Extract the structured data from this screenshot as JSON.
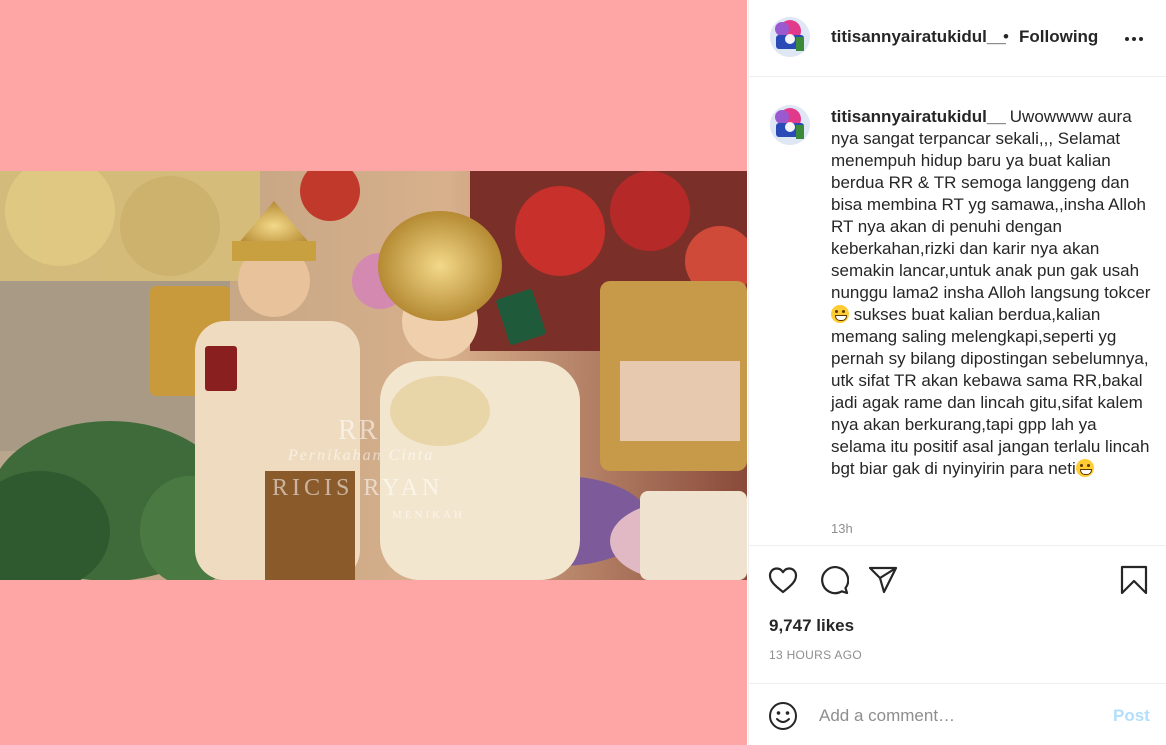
{
  "colors": {
    "media_background": "#fea6a6",
    "text_primary": "#262626",
    "text_secondary": "#8e8e8e",
    "post_button_disabled": "#b2dffc",
    "divider": "#efefef"
  },
  "media": {
    "watermark": {
      "line1": "RR",
      "line2": "Pernikahan Cinta",
      "line3": "RICIS RYAN",
      "line4": "MENIKAH"
    }
  },
  "header": {
    "username": "titisannyairatukidul__",
    "separator": "•",
    "follow_status": "Following",
    "more_icon": "more-horizontal-icon"
  },
  "caption": {
    "username": "titisannyairatukidul__",
    "text_part1": "Uwowwww aura nya sangat terpancar sekali,,, Selamat menempuh hidup baru ya buat kalian berdua RR & TR semoga langgeng dan bisa membina RT yg samawa,,insha Alloh RT nya akan di penuhi dengan keberkahan,rizki dan karir nya akan semakin lancar,untuk anak pun gak usah nunggu lama2 insha Alloh langsung tokcer",
    "text_part2": " sukses buat kalian berdua,kalian memang saling melengkapi,seperti yg pernah sy bilang dipostingan sebelumnya, utk sifat TR akan kebawa sama RR,bakal jadi agak rame dan lincah gitu,sifat kalem nya akan berkurang,tapi gpp lah ya selama itu positif asal jangan terlalu lincah bgt biar gak di nyinyirin para neti",
    "emoji": "grinning-face-emoji",
    "time": "13h"
  },
  "actions": {
    "like_icon": "heart-icon",
    "comment_icon": "comment-icon",
    "share_icon": "paper-plane-icon",
    "save_icon": "bookmark-icon",
    "likes": "9,747 likes",
    "posted_ago": "13 HOURS AGO"
  },
  "add_comment": {
    "emoji_icon": "smiley-icon",
    "placeholder": "Add a comment…",
    "post_label": "Post"
  }
}
